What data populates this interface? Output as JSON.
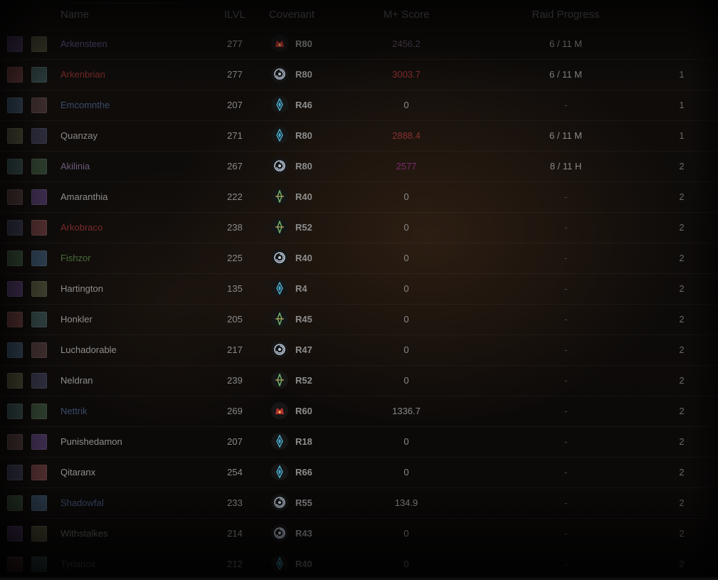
{
  "header": {
    "name": "Name",
    "ilvl": "ILVL",
    "covenant": "Covenant",
    "score": "M+ Score",
    "raid": "Raid Progress"
  },
  "colors": {
    "kyrian": "#b8c6d6",
    "venthyr": "#b0302c",
    "nightfae": "#4aa8c8",
    "necrolord": "#6fb06a",
    "score_high": "#8a3030",
    "score_purple": "#7a2a6a"
  },
  "rows": [
    {
      "name": "Arkensteen",
      "nameColor": "#5a4a7a",
      "ilvl": "277",
      "covenant": "venthyr",
      "rank": "R80",
      "score": "2456.2",
      "scoreColor": "#5a4a5a",
      "raid": "6 / 11 M",
      "guild": ""
    },
    {
      "name": "Arkenbrian",
      "nameColor": "#7a2a2a",
      "ilvl": "277",
      "covenant": "kyrian",
      "rank": "R80",
      "score": "3003.7",
      "scoreColor": "#8a3030",
      "raid": "6 / 11 M",
      "guild": "1"
    },
    {
      "name": "Emcomnthe",
      "nameColor": "#3a4a6a",
      "ilvl": "207",
      "covenant": "nightfae",
      "rank": "R46",
      "score": "0",
      "scoreColor": "",
      "raid": "-",
      "guild": "1"
    },
    {
      "name": "Quanzay",
      "nameColor": "#8a8a8a",
      "ilvl": "271",
      "covenant": "nightfae",
      "rank": "R80",
      "score": "2888.4",
      "scoreColor": "#8a3030",
      "raid": "6 / 11 M",
      "guild": "1"
    },
    {
      "name": "Akilinia",
      "nameColor": "#6a5a7a",
      "ilvl": "267",
      "covenant": "kyrian",
      "rank": "R80",
      "score": "2577",
      "scoreColor": "#7a2a6a",
      "raid": "8 / 11 H",
      "guild": "2"
    },
    {
      "name": "Amaranthia",
      "nameColor": "#8e8e8e",
      "ilvl": "222",
      "covenant": "necrolord",
      "rank": "R40",
      "score": "0",
      "scoreColor": "",
      "raid": "-",
      "guild": "2"
    },
    {
      "name": "Arkobraco",
      "nameColor": "#7a2a2a",
      "ilvl": "238",
      "covenant": "necrolord",
      "rank": "R52",
      "score": "0",
      "scoreColor": "",
      "raid": "-",
      "guild": "2"
    },
    {
      "name": "Fishzor",
      "nameColor": "#4a6a3a",
      "ilvl": "225",
      "covenant": "kyrian",
      "rank": "R40",
      "score": "0",
      "scoreColor": "",
      "raid": "-",
      "guild": "2"
    },
    {
      "name": "Hartington",
      "nameColor": "#8e8e8e",
      "ilvl": "135",
      "covenant": "nightfae",
      "rank": "R4",
      "score": "0",
      "scoreColor": "",
      "raid": "-",
      "guild": "2"
    },
    {
      "name": "Honkler",
      "nameColor": "#8e8e8e",
      "ilvl": "205",
      "covenant": "necrolord",
      "rank": "R45",
      "score": "0",
      "scoreColor": "",
      "raid": "-",
      "guild": "2"
    },
    {
      "name": "Luchadorable",
      "nameColor": "#8e8e8e",
      "ilvl": "217",
      "covenant": "kyrian",
      "rank": "R47",
      "score": "0",
      "scoreColor": "",
      "raid": "-",
      "guild": "2"
    },
    {
      "name": "Neldran",
      "nameColor": "#8e8e8e",
      "ilvl": "239",
      "covenant": "necrolord",
      "rank": "R52",
      "score": "0",
      "scoreColor": "",
      "raid": "-",
      "guild": "2"
    },
    {
      "name": "Nettrik",
      "nameColor": "#3a4a6a",
      "ilvl": "269",
      "covenant": "venthyr",
      "rank": "R60",
      "score": "1336.7",
      "scoreColor": "",
      "raid": "-",
      "guild": "2"
    },
    {
      "name": "Punishedamon",
      "nameColor": "#8e8e8e",
      "ilvl": "207",
      "covenant": "nightfae",
      "rank": "R18",
      "score": "0",
      "scoreColor": "",
      "raid": "-",
      "guild": "2"
    },
    {
      "name": "Qitaranx",
      "nameColor": "#8e8e8e",
      "ilvl": "254",
      "covenant": "nightfae",
      "rank": "R66",
      "score": "0",
      "scoreColor": "",
      "raid": "-",
      "guild": "2"
    },
    {
      "name": "Shadowfal",
      "nameColor": "#3a4a6a",
      "ilvl": "233",
      "covenant": "kyrian",
      "rank": "R55",
      "score": "134.9",
      "scoreColor": "",
      "raid": "-",
      "guild": "2"
    },
    {
      "name": "Withstalkes",
      "nameColor": "#5a5a5a",
      "ilvl": "214",
      "covenant": "kyrian",
      "rank": "R43",
      "score": "0",
      "scoreColor": "",
      "raid": "-",
      "guild": "2"
    },
    {
      "name": "Tyrianox",
      "nameColor": "#4a4a4a",
      "ilvl": "212",
      "covenant": "nightfae",
      "rank": "R40",
      "score": "0",
      "scoreColor": "",
      "raid": "-",
      "guild": "2"
    }
  ]
}
